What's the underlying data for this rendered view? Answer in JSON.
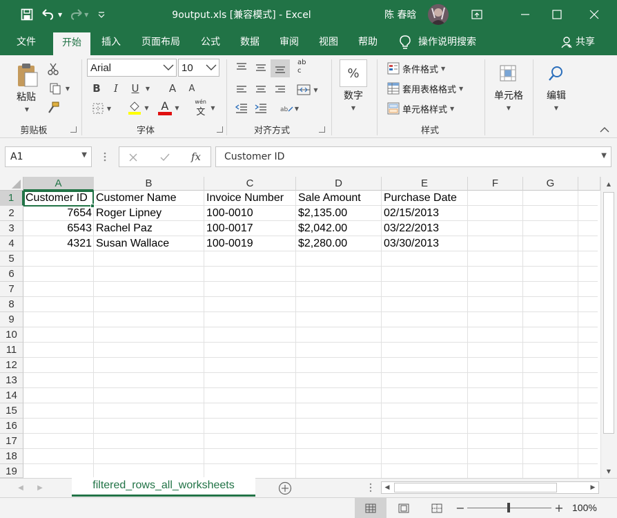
{
  "window": {
    "doc_title": "9output.xls  [兼容模式]  -  Excel",
    "user_name": "陈 春晗",
    "accent_color": "#217346"
  },
  "tabs": [
    {
      "label": "文件"
    },
    {
      "label": "开始"
    },
    {
      "label": "插入"
    },
    {
      "label": "页面布局"
    },
    {
      "label": "公式"
    },
    {
      "label": "数据"
    },
    {
      "label": "审阅"
    },
    {
      "label": "视图"
    },
    {
      "label": "帮助"
    }
  ],
  "tell_me": "操作说明搜索",
  "share": "共享",
  "ribbon": {
    "paste_label": "粘贴",
    "clipboard_label": "剪贴板",
    "font_name": "Arial",
    "font_size": "10",
    "font_label": "字体",
    "wen_glyph": "wén",
    "wen_char": "文",
    "align_label": "对齐方式",
    "number_label": "数字",
    "percent": "%",
    "cond_format": "条件格式",
    "table_format": "套用表格格式",
    "cell_styles": "单元格样式",
    "styles_label": "样式",
    "cells_label": "单元格",
    "edit_label": "编辑",
    "bold": "B",
    "italic": "I",
    "underline": "U",
    "grow": "A",
    "shrink": "A",
    "color_a": "A",
    "abc": "ab",
    "c_char": "c"
  },
  "formula_bar": {
    "name_box": "A1",
    "formula": "Customer ID",
    "fx": "fx"
  },
  "sheet": {
    "columns": [
      "A",
      "B",
      "C",
      "D",
      "E",
      "F",
      "G"
    ],
    "rows": [
      "1",
      "2",
      "3",
      "4",
      "5",
      "6",
      "7",
      "8",
      "9",
      "10",
      "11",
      "12",
      "13",
      "14",
      "15",
      "16",
      "17",
      "18",
      "19"
    ],
    "headers": [
      "Customer ID",
      "Customer Name",
      "Invoice Number",
      "Sale Amount",
      "Purchase Date"
    ],
    "data": [
      [
        "7654",
        "Roger Lipney",
        "100-0010",
        "$2,135.00",
        "02/15/2013"
      ],
      [
        "6543",
        "Rachel Paz",
        "100-0017",
        "$2,042.00",
        "03/22/2013"
      ],
      [
        "4321",
        "Susan Wallace",
        "100-0019",
        "$2,280.00",
        "03/30/2013"
      ]
    ],
    "selected_cell": "A1"
  },
  "sheet_tab": "filtered_rows_all_worksheets",
  "status": {
    "zoom": "100%",
    "minus": "−",
    "plus": "+"
  }
}
